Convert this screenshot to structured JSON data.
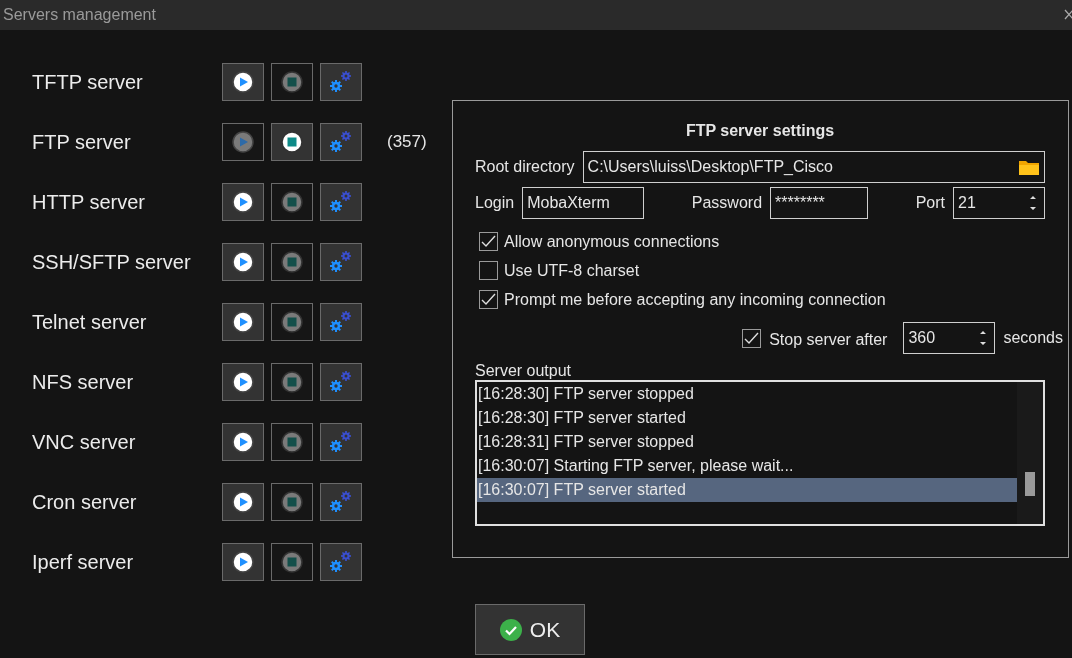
{
  "window": {
    "title": "Servers management"
  },
  "servers": [
    {
      "name": "TFTP server",
      "running": false
    },
    {
      "name": "FTP server",
      "running": true,
      "count": "(357)"
    },
    {
      "name": "HTTP server",
      "running": false
    },
    {
      "name": "SSH/SFTP server",
      "running": false
    },
    {
      "name": "Telnet server",
      "running": false
    },
    {
      "name": "NFS server",
      "running": false
    },
    {
      "name": "VNC server",
      "running": false
    },
    {
      "name": "Cron server",
      "running": false
    },
    {
      "name": "Iperf server",
      "running": false
    }
  ],
  "settings": {
    "title": "FTP server settings",
    "root_label": "Root directory",
    "root_value": "C:\\Users\\luiss\\Desktop\\FTP_Cisco",
    "login_label": "Login",
    "login_value": "MobaXterm",
    "password_label": "Password",
    "password_value": "********",
    "port_label": "Port",
    "port_value": "21",
    "options": [
      {
        "label": "Allow anonymous connections",
        "checked": true
      },
      {
        "label": "Use UTF-8 charset",
        "checked": false
      },
      {
        "label": "Prompt me before accepting any incoming connection",
        "checked": true
      }
    ],
    "stop_after": {
      "label": "Stop server after",
      "checked": true,
      "value": "360",
      "unit": "seconds"
    },
    "output_label": "Server output",
    "output": [
      {
        "text": "[16:28:30] FTP server stopped",
        "selected": false
      },
      {
        "text": "[16:28:30] FTP server started",
        "selected": false
      },
      {
        "text": "[16:28:31] FTP server stopped",
        "selected": false
      },
      {
        "text": "[16:30:07] Starting FTP server, please wait...",
        "selected": false
      },
      {
        "text": "[16:30:07] FTP server started",
        "selected": true
      }
    ]
  },
  "ok_button": "OK"
}
